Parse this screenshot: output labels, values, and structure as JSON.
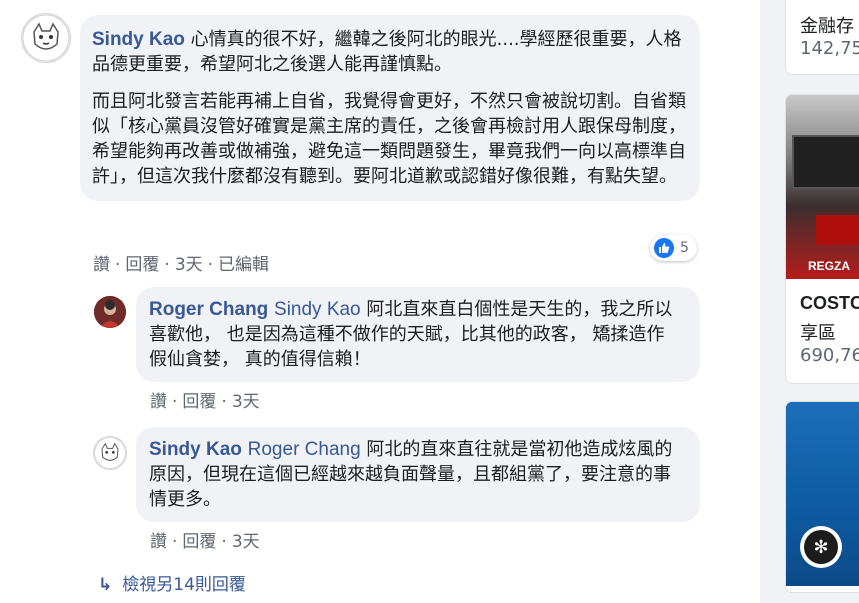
{
  "comments": [
    {
      "author": "Sindy Kao",
      "paragraph1_text": "心情真的很不好，繼韓之後阿北的眼光....學經歷很重要，人格品德更重要，希望阿北之後選人能再謹慎點。",
      "paragraph2_text": "而且阿北發言若能再補上自省，我覺得會更好，不然只會被說切割。自省類似「核心黨員沒管好確實是黨主席的責任，之後會再檢討用人跟保母制度，希望能夠再改善或做補強，避免這一類問題發生，畢竟我們一向以高標準自許」，但這次我什麼都沒有聽到。要阿北道歉或認錯好像很難，有點失望。",
      "like": "讚",
      "reply": "回覆",
      "time": "3天",
      "edited": "已編輯",
      "reaction_count": "5"
    },
    {
      "author": "Roger Chang",
      "mention": "Sindy Kao",
      "text": "阿北直來直白個性是天生的，我之所以喜歡他， 也是因為這種不做作的天賦，比其他的政客， 矯揉造作 假仙貪婪， 真的值得信賴！",
      "like": "讚",
      "reply": "回覆",
      "time": "3天"
    },
    {
      "author": "Sindy Kao",
      "mention": "Roger Chang",
      "text": "阿北的直來直往就是當初他造成炫風的原因，但現在這個已經越來越負面聲量，且都組黨了，要注意的事情更多。",
      "like": "讚",
      "reply": "回覆",
      "time": "3天"
    }
  ],
  "more_replies_label": "檢視另14則回覆",
  "sidebar": {
    "card1_title": "金融存",
    "card1_count": "142,75",
    "card2_title": "COSTC",
    "card2_subtitle": "享區",
    "card2_count": "690,76",
    "card2_image_text": "REGZA"
  },
  "colors": {
    "link_blue": "#385898",
    "bubble_gray": "#f0f2f5",
    "meta_gray": "#606770",
    "like_blue": "#1877f2"
  },
  "icons": [
    "sindy-avatar-icon",
    "roger-avatar-icon",
    "like-reaction-icon",
    "reply-arrow-icon",
    "sidebar-logo-icon"
  ]
}
